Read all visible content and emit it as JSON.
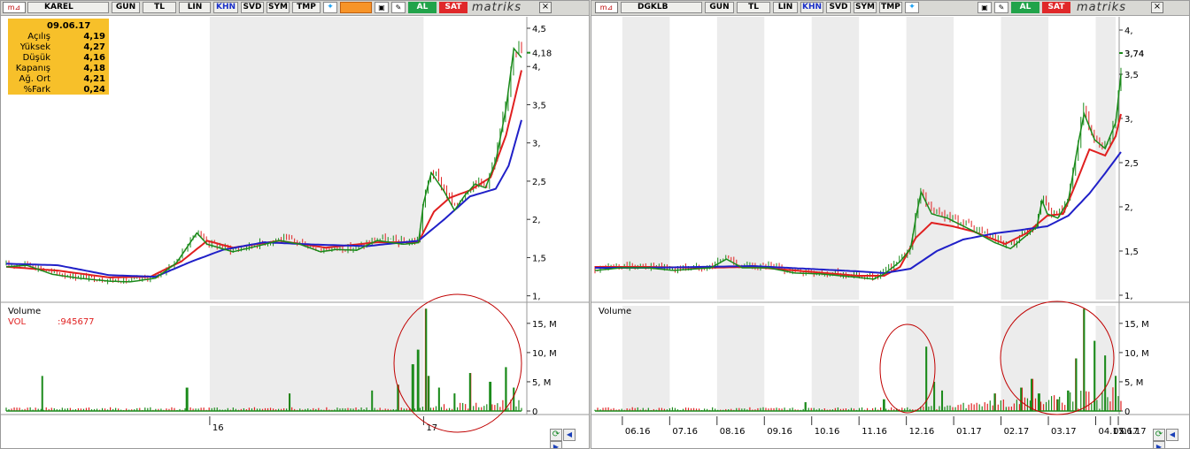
{
  "toolbar": {
    "common_buttons": [
      "GUN",
      "TL",
      "LIN",
      "KHN",
      "SVD",
      "SYM",
      "TMP"
    ],
    "al_label": "AL",
    "sat_label": "SAT",
    "brand": "matriks",
    "close_label": "×"
  },
  "panels": [
    {
      "symbol": "KAREL",
      "info_box": {
        "date": "09.06.17",
        "rows": [
          {
            "label": "Açılış",
            "value": "4,19"
          },
          {
            "label": "Yüksek",
            "value": "4,27"
          },
          {
            "label": "Düşük",
            "value": "4,16"
          },
          {
            "label": "Kapanış",
            "value": "4,18"
          },
          {
            "label": "Ağ. Ort",
            "value": "4,21"
          },
          {
            "label": "%Fark",
            "value": "0,24"
          }
        ]
      },
      "volume_title": "Volume",
      "volume_legend_label": "VOL",
      "volume_legend_value": ":945677",
      "last_price_label": "4,18"
    },
    {
      "symbol": "DGKLB",
      "volume_title": "Volume",
      "last_price_label": "3,74"
    }
  ],
  "chart_data": [
    {
      "type": "candlestick",
      "symbol": "KAREL",
      "price_ticks": [
        "4,5",
        "4,",
        "3,5",
        "3,",
        "2,5",
        "2,",
        "1,5",
        "1,"
      ],
      "price_tick_values": [
        4.5,
        4.0,
        3.5,
        3.0,
        2.5,
        2.0,
        1.5,
        1.0
      ],
      "ylim": [
        0.95,
        4.65
      ],
      "volume_ticks": [
        "15, M",
        "10, M",
        "5, M",
        "0"
      ],
      "volume_tick_values": [
        15,
        10,
        5,
        0
      ],
      "volume_ylim": [
        0,
        18
      ],
      "x_labels": [
        "16",
        "17"
      ],
      "x_label_fractions": [
        0.395,
        0.81
      ],
      "shaded_fraction_ranges": [
        [
          0.395,
          0.81
        ]
      ],
      "series": [
        {
          "name": "Price",
          "color": "#1a8a1a",
          "keypoints": [
            [
              0.0,
              1.4
            ],
            [
              0.04,
              1.42
            ],
            [
              0.09,
              1.3
            ],
            [
              0.14,
              1.25
            ],
            [
              0.2,
              1.21
            ],
            [
              0.24,
              1.2
            ],
            [
              0.29,
              1.25
            ],
            [
              0.33,
              1.45
            ],
            [
              0.37,
              1.85
            ],
            [
              0.39,
              1.7
            ],
            [
              0.44,
              1.6
            ],
            [
              0.49,
              1.68
            ],
            [
              0.53,
              1.75
            ],
            [
              0.57,
              1.7
            ],
            [
              0.61,
              1.6
            ],
            [
              0.64,
              1.63
            ],
            [
              0.68,
              1.62
            ],
            [
              0.72,
              1.75
            ],
            [
              0.77,
              1.7
            ],
            [
              0.8,
              1.72
            ],
            [
              0.81,
              2.25
            ],
            [
              0.825,
              2.65
            ],
            [
              0.85,
              2.4
            ],
            [
              0.87,
              2.15
            ],
            [
              0.89,
              2.35
            ],
            [
              0.91,
              2.5
            ],
            [
              0.93,
              2.45
            ],
            [
              0.95,
              2.8
            ],
            [
              0.97,
              3.5
            ],
            [
              0.985,
              4.3
            ],
            [
              1.0,
              4.18
            ]
          ]
        },
        {
          "name": "MA fast",
          "color": "#e02020",
          "keypoints": [
            [
              0.0,
              1.38
            ],
            [
              0.1,
              1.33
            ],
            [
              0.2,
              1.24
            ],
            [
              0.28,
              1.25
            ],
            [
              0.34,
              1.45
            ],
            [
              0.39,
              1.72
            ],
            [
              0.44,
              1.63
            ],
            [
              0.53,
              1.72
            ],
            [
              0.62,
              1.63
            ],
            [
              0.72,
              1.7
            ],
            [
              0.8,
              1.7
            ],
            [
              0.83,
              2.1
            ],
            [
              0.86,
              2.28
            ],
            [
              0.9,
              2.38
            ],
            [
              0.94,
              2.55
            ],
            [
              0.97,
              3.1
            ],
            [
              1.0,
              3.95
            ]
          ]
        },
        {
          "name": "MA slow",
          "color": "#2020c8",
          "keypoints": [
            [
              0.0,
              1.42
            ],
            [
              0.1,
              1.4
            ],
            [
              0.2,
              1.27
            ],
            [
              0.29,
              1.25
            ],
            [
              0.36,
              1.45
            ],
            [
              0.42,
              1.6
            ],
            [
              0.5,
              1.7
            ],
            [
              0.6,
              1.67
            ],
            [
              0.7,
              1.65
            ],
            [
              0.8,
              1.72
            ],
            [
              0.85,
              2.0
            ],
            [
              0.9,
              2.3
            ],
            [
              0.95,
              2.4
            ],
            [
              0.975,
              2.7
            ],
            [
              1.0,
              3.3
            ]
          ]
        }
      ],
      "volume_spikes": [
        [
          0.07,
          6
        ],
        [
          0.35,
          4
        ],
        [
          0.55,
          3
        ],
        [
          0.71,
          3.5
        ],
        [
          0.76,
          4.5
        ],
        [
          0.79,
          8
        ],
        [
          0.8,
          10.5
        ],
        [
          0.815,
          17.5
        ],
        [
          0.82,
          6
        ],
        [
          0.84,
          4
        ],
        [
          0.87,
          3
        ],
        [
          0.9,
          6.5
        ],
        [
          0.94,
          5
        ],
        [
          0.97,
          7.5
        ],
        [
          0.985,
          4
        ]
      ]
    },
    {
      "type": "candlestick",
      "symbol": "DGKLB",
      "price_ticks": [
        "4,",
        "3,74",
        "3,5",
        "3,",
        "2,5",
        "2,",
        "1,5",
        "1,"
      ],
      "price_tick_values": [
        4.0,
        3.74,
        3.5,
        3.0,
        2.5,
        2.0,
        1.5,
        1.0
      ],
      "ylim": [
        0.95,
        4.15
      ],
      "volume_ticks": [
        "15, M",
        "10, M",
        "5, M",
        "0"
      ],
      "volume_tick_values": [
        15,
        10,
        5,
        0
      ],
      "volume_ylim": [
        0,
        18
      ],
      "x_labels": [
        "06.16",
        "07.16",
        "08.16",
        "09.16",
        "10.16",
        "11.16",
        "12.16",
        "01.17",
        "02.17",
        "03.17",
        "04.17",
        "05.17",
        "06.17"
      ],
      "x_label_fractions": [
        0.052,
        0.142,
        0.232,
        0.322,
        0.412,
        0.502,
        0.592,
        0.682,
        0.772,
        0.862,
        0.952,
        0.98,
        0.995
      ],
      "shaded_fraction_ranges": [
        [
          0.052,
          0.142
        ],
        [
          0.232,
          0.322
        ],
        [
          0.412,
          0.502
        ],
        [
          0.592,
          0.682
        ],
        [
          0.772,
          0.862
        ],
        [
          0.952,
          0.99
        ]
      ],
      "series": [
        {
          "name": "Price",
          "color": "#1a8a1a",
          "keypoints": [
            [
              0.0,
              1.3
            ],
            [
              0.05,
              1.33
            ],
            [
              0.1,
              1.33
            ],
            [
              0.15,
              1.3
            ],
            [
              0.22,
              1.33
            ],
            [
              0.25,
              1.43
            ],
            [
              0.28,
              1.33
            ],
            [
              0.33,
              1.33
            ],
            [
              0.38,
              1.27
            ],
            [
              0.43,
              1.26
            ],
            [
              0.5,
              1.22
            ],
            [
              0.53,
              1.2
            ],
            [
              0.55,
              1.26
            ],
            [
              0.58,
              1.4
            ],
            [
              0.6,
              1.55
            ],
            [
              0.61,
              1.9
            ],
            [
              0.62,
              2.2
            ],
            [
              0.64,
              1.95
            ],
            [
              0.67,
              1.9
            ],
            [
              0.72,
              1.75
            ],
            [
              0.76,
              1.62
            ],
            [
              0.79,
              1.55
            ],
            [
              0.82,
              1.7
            ],
            [
              0.84,
              1.8
            ],
            [
              0.85,
              2.1
            ],
            [
              0.86,
              1.95
            ],
            [
              0.88,
              1.9
            ],
            [
              0.9,
              2.1
            ],
            [
              0.92,
              2.8
            ],
            [
              0.93,
              3.1
            ],
            [
              0.95,
              2.8
            ],
            [
              0.97,
              2.7
            ],
            [
              0.99,
              3.0
            ],
            [
              1.0,
              3.55
            ]
          ]
        },
        {
          "name": "MA fast",
          "color": "#e02020",
          "keypoints": [
            [
              0.0,
              1.32
            ],
            [
              0.1,
              1.32
            ],
            [
              0.2,
              1.31
            ],
            [
              0.3,
              1.32
            ],
            [
              0.4,
              1.27
            ],
            [
              0.5,
              1.22
            ],
            [
              0.55,
              1.22
            ],
            [
              0.58,
              1.32
            ],
            [
              0.61,
              1.65
            ],
            [
              0.64,
              1.82
            ],
            [
              0.68,
              1.78
            ],
            [
              0.72,
              1.72
            ],
            [
              0.78,
              1.58
            ],
            [
              0.82,
              1.7
            ],
            [
              0.86,
              1.9
            ],
            [
              0.89,
              1.92
            ],
            [
              0.91,
              2.2
            ],
            [
              0.94,
              2.65
            ],
            [
              0.97,
              2.58
            ],
            [
              0.99,
              2.8
            ],
            [
              1.0,
              3.05
            ]
          ]
        },
        {
          "name": "MA slow",
          "color": "#2020c8",
          "keypoints": [
            [
              0.0,
              1.31
            ],
            [
              0.1,
              1.31
            ],
            [
              0.2,
              1.32
            ],
            [
              0.3,
              1.33
            ],
            [
              0.4,
              1.3
            ],
            [
              0.5,
              1.27
            ],
            [
              0.55,
              1.25
            ],
            [
              0.6,
              1.3
            ],
            [
              0.65,
              1.5
            ],
            [
              0.7,
              1.63
            ],
            [
              0.76,
              1.7
            ],
            [
              0.8,
              1.73
            ],
            [
              0.86,
              1.78
            ],
            [
              0.9,
              1.9
            ],
            [
              0.94,
              2.15
            ],
            [
              0.97,
              2.38
            ],
            [
              1.0,
              2.62
            ]
          ]
        }
      ],
      "volume_spikes": [
        [
          0.4,
          1.5
        ],
        [
          0.55,
          2
        ],
        [
          0.63,
          11
        ],
        [
          0.645,
          5
        ],
        [
          0.66,
          3.5
        ],
        [
          0.76,
          3
        ],
        [
          0.81,
          4
        ],
        [
          0.83,
          5.5
        ],
        [
          0.845,
          3
        ],
        [
          0.88,
          2
        ],
        [
          0.9,
          3.5
        ],
        [
          0.915,
          9
        ],
        [
          0.93,
          17.5
        ],
        [
          0.95,
          12
        ],
        [
          0.97,
          9.5
        ],
        [
          0.99,
          6
        ]
      ]
    }
  ],
  "annotations": [
    {
      "panel": "KAREL",
      "note": "red circle around volume surge",
      "color": "#c00000"
    },
    {
      "panel": "DGKLB",
      "note": "red circle around volume surge (01.17)",
      "color": "#c00000"
    },
    {
      "panel": "DGKLB",
      "note": "red circle around volume surge (04.17-05.17)",
      "color": "#c00000"
    }
  ],
  "colors": {
    "up": "#1a8a1a",
    "down": "#e02020",
    "ma_slow": "#2020c8",
    "shade": "#ececec",
    "info_bg": "#f7c02a",
    "circle": "#c00000"
  }
}
